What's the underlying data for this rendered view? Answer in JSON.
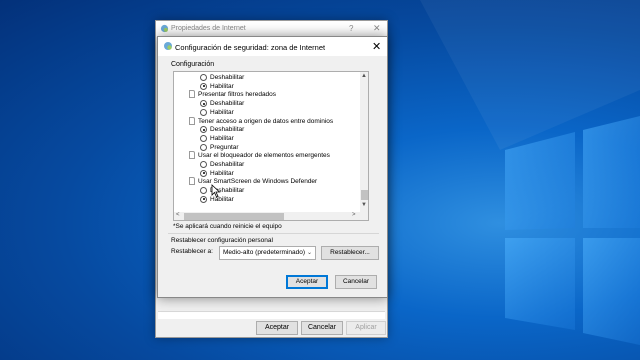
{
  "outer_window": {
    "title": "Propiedades de Internet",
    "help_glyph": "?",
    "close_glyph": "✕",
    "buttons": {
      "accept": "Aceptar",
      "cancel": "Cancelar",
      "apply": "Aplicar"
    }
  },
  "dialog": {
    "title": "Configuración de seguridad: zona de Internet",
    "close_glyph": "✕",
    "section_label": "Configuración",
    "tree": [
      {
        "type": "option",
        "label": "Deshabilitar",
        "selected": false
      },
      {
        "type": "option",
        "label": "Habilitar",
        "selected": true
      },
      {
        "type": "category",
        "label": "Presentar filtros heredados"
      },
      {
        "type": "option",
        "label": "Deshabilitar",
        "selected": true
      },
      {
        "type": "option",
        "label": "Habilitar",
        "selected": false
      },
      {
        "type": "category",
        "label": "Tener acceso a origen de datos entre dominios"
      },
      {
        "type": "option",
        "label": "Deshabilitar",
        "selected": true
      },
      {
        "type": "option",
        "label": "Habilitar",
        "selected": false
      },
      {
        "type": "option",
        "label": "Preguntar",
        "selected": false
      },
      {
        "type": "category",
        "label": "Usar el bloqueador de elementos emergentes"
      },
      {
        "type": "option",
        "label": "Deshabilitar",
        "selected": false
      },
      {
        "type": "option",
        "label": "Habilitar",
        "selected": true
      },
      {
        "type": "category",
        "label": "Usar SmartScreen de Windows Defender"
      },
      {
        "type": "option",
        "label": "Deshabilitar",
        "selected": false
      },
      {
        "type": "option",
        "label": "Habilitar",
        "selected": true
      }
    ],
    "scroll_glyphs": {
      "up": "▲",
      "down": "▼",
      "left": "<",
      "right": ">"
    },
    "note": "*Se aplicará cuando reinicie el equipo",
    "reset": {
      "title": "Restablecer configuración personal",
      "to_label": "Restablecer a:",
      "selected_level": "Medio-alto (predeterminado)",
      "chevron": "⌄",
      "button": "Restablecer..."
    },
    "buttons": {
      "accept": "Aceptar",
      "cancel": "Cancelar"
    }
  },
  "colors": {
    "accent": "#0078d7",
    "desktop_blue": "#0a66c8"
  }
}
